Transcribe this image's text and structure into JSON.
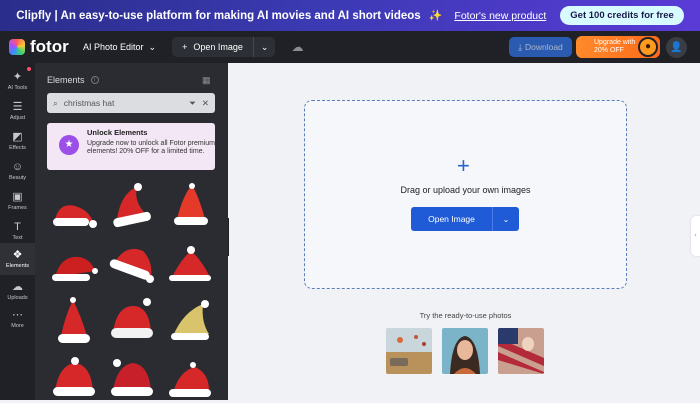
{
  "banner": {
    "headline": "Clipfly | An easy-to-use platform for making AI movies and AI short videos",
    "sparkle": "✨",
    "link": "Fotor's new product",
    "credits": "Get 100 credits for free"
  },
  "topbar": {
    "logo": "fotor",
    "editor": "AI Photo Editor",
    "open_image": "Open Image",
    "download": "Download",
    "upgrade_line1": "Upgrade with",
    "upgrade_line2": "20% OFF"
  },
  "rail": {
    "items": [
      {
        "label": "AI Tools",
        "icon": "✦"
      },
      {
        "label": "Adjust",
        "icon": "☰"
      },
      {
        "label": "Effects",
        "icon": "◩"
      },
      {
        "label": "Beauty",
        "icon": "☺"
      },
      {
        "label": "Frames",
        "icon": "▣"
      },
      {
        "label": "Text",
        "icon": "T"
      },
      {
        "label": "Elements",
        "icon": "❖"
      },
      {
        "label": "Uploads",
        "icon": "☁"
      },
      {
        "label": "More",
        "icon": "⋯"
      }
    ]
  },
  "panel": {
    "title": "Elements",
    "search_value": "christmas hat",
    "unlock_title": "Unlock Elements",
    "unlock_body": "Upgrade now to unlock all Fotor premium elements! 20% OFF for a limited time."
  },
  "canvas": {
    "drop_text": "Drag or upload your own images",
    "open_image": "Open Image",
    "try_text": "Try the ready-to-use photos"
  },
  "colors": {
    "accent": "#1f5bd6",
    "banner": "#3b3ab3",
    "hat_red": "#d62828",
    "upgrade": "#ff7a22"
  }
}
